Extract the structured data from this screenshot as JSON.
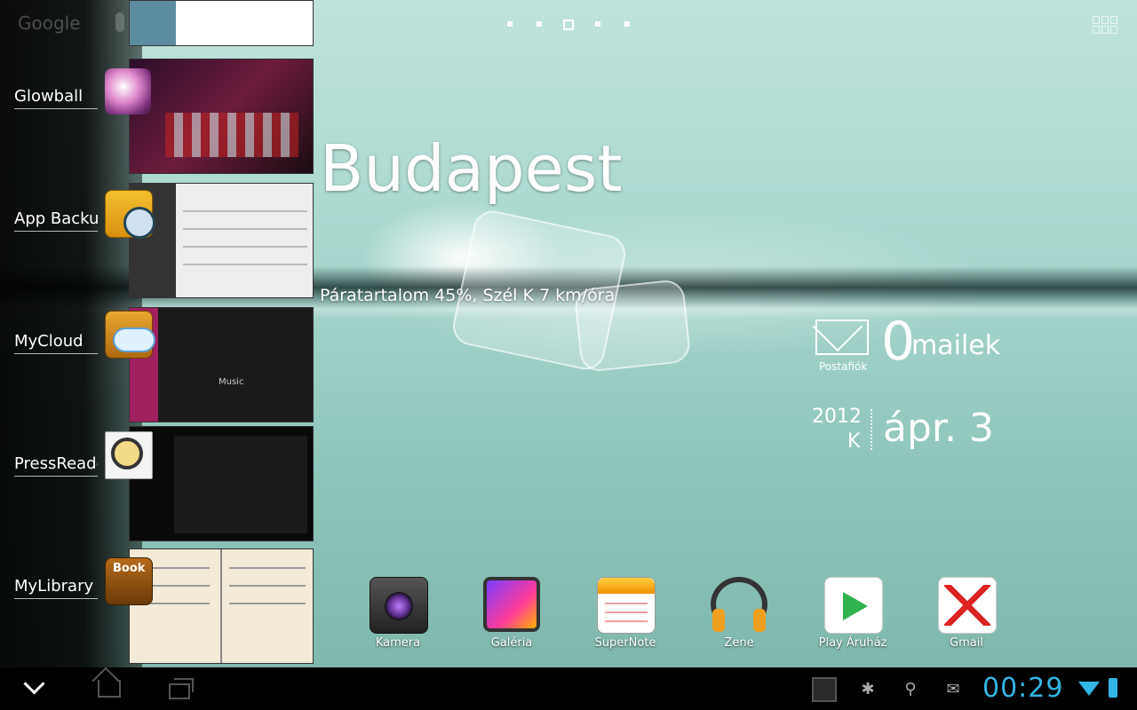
{
  "search": {
    "label": "Google"
  },
  "weather": {
    "city": "Budapest",
    "detail": "Páratartalom 45%, Szél K 7 km/óra"
  },
  "mail": {
    "count": "0",
    "unit": "mailek",
    "label": "Postafiók"
  },
  "date": {
    "year": "2012",
    "weekday": "K",
    "day": "ápr. 3"
  },
  "recent_apps": [
    {
      "label": "Glowball"
    },
    {
      "label": "App Backup"
    },
    {
      "label": "MyCloud"
    },
    {
      "label": "PressReader"
    },
    {
      "label": "MyLibrary"
    }
  ],
  "thumbs": {
    "mycloud_music": "Music",
    "mylibrary_book": "Book"
  },
  "dock": [
    {
      "label": "Kamera"
    },
    {
      "label": "Galéria"
    },
    {
      "label": "SuperNote"
    },
    {
      "label": "Zene"
    },
    {
      "label": "Play Áruház"
    },
    {
      "label": "Gmail"
    }
  ],
  "status": {
    "clock": "00:29"
  },
  "colors": {
    "accent": "#33b5e5"
  }
}
